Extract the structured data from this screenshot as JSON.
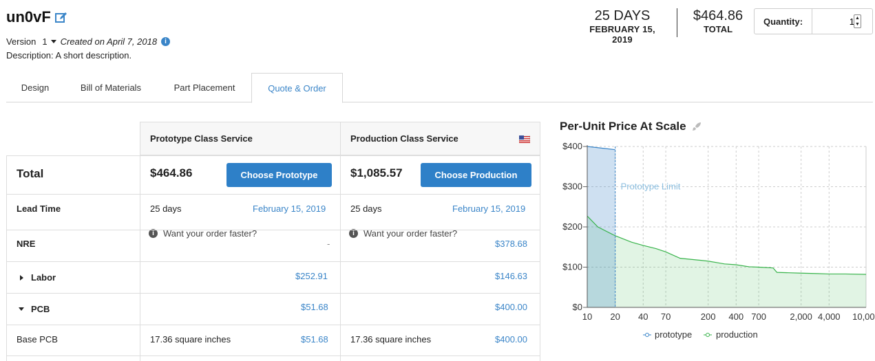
{
  "project": {
    "name": "un0vF",
    "version_label": "Version",
    "version": "1",
    "created": "Created on April 7, 2018",
    "description": "Description: A short description."
  },
  "summary": {
    "days": "25 DAYS",
    "date": "FEBRUARY 15, 2019",
    "total": "$464.86",
    "total_label": "TOTAL",
    "quantity_label": "Quantity:",
    "quantity": "1"
  },
  "tabs": [
    "Design",
    "Bill of Materials",
    "Part Placement",
    "Quote & Order"
  ],
  "active_tab": 3,
  "quote": {
    "prototype_header": "Prototype Class Service",
    "production_header": "Production Class Service",
    "rows": {
      "total": {
        "label": "Total",
        "prototype": "$464.86",
        "production": "$1,085.57"
      },
      "lead_time": {
        "label": "Lead Time",
        "prototype_days": "25 days",
        "prototype_date": "February 15, 2019",
        "production_days": "25 days",
        "production_date": "February 15, 2019",
        "faster": "Want your order faster?"
      },
      "nre": {
        "label": "NRE",
        "prototype": "-",
        "production": "$378.68"
      },
      "labor": {
        "label": "Labor",
        "prototype": "$252.91",
        "production": "$146.63"
      },
      "pcb": {
        "label": "PCB",
        "prototype": "$51.68",
        "production": "$400.00"
      },
      "base_pcb": {
        "label": "Base PCB",
        "prototype_area": "17.36 square inches",
        "prototype": "$51.68",
        "production_area": "17.36 square inches",
        "production": "$400.00"
      }
    },
    "choose_prototype": "Choose Prototype",
    "choose_production": "Choose Production"
  },
  "chart_data": {
    "type": "area",
    "title": "Per-Unit Price At Scale",
    "x_scale": "log",
    "x_ticks": [
      10,
      20,
      40,
      70,
      200,
      400,
      700,
      2000,
      4000,
      10000
    ],
    "x_tick_labels": [
      "10",
      "20",
      "40",
      "70",
      "200",
      "400",
      "700",
      "2,000",
      "4,000",
      "10,000"
    ],
    "y_ticks": [
      0,
      100,
      200,
      300,
      400
    ],
    "y_tick_labels": [
      "$0",
      "$100",
      "$200",
      "$300",
      "$400"
    ],
    "ylim": [
      0,
      400
    ],
    "xlim": [
      10,
      10000
    ],
    "grid": true,
    "legend_position": "bottom",
    "annotation": "Prototype Limit",
    "annotation_x": 20,
    "series": [
      {
        "name": "prototype",
        "color": "#3a85c8",
        "x": [
          10,
          20
        ],
        "y": [
          400,
          392
        ]
      },
      {
        "name": "production",
        "color": "#37b34a",
        "x": [
          10,
          13,
          20,
          30,
          40,
          55,
          70,
          100,
          150,
          200,
          300,
          400,
          550,
          700,
          1000,
          1100,
          1500,
          2000,
          3000,
          4000,
          6000,
          10000
        ],
        "y": [
          227,
          200,
          178,
          162,
          154,
          146,
          138,
          122,
          118,
          115,
          108,
          106,
          101,
          100,
          98,
          87,
          86,
          85,
          84,
          83,
          83,
          82
        ]
      }
    ]
  }
}
